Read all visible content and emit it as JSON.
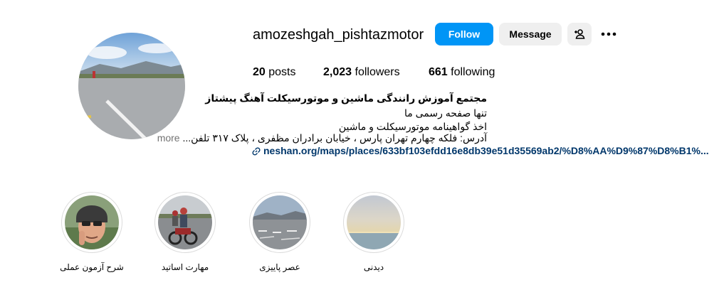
{
  "profile": {
    "username": "amozeshgah_pishtazmotor",
    "follow_label": "Follow",
    "message_label": "Message",
    "icons": {
      "suggest": "add-person-icon",
      "options": "more-options-icon",
      "link": "link-icon"
    },
    "accent_color": "#0095f6"
  },
  "stats": {
    "posts_count": "20",
    "posts_label": " posts",
    "followers_count": "2,023",
    "followers_label": " followers",
    "following_count": "661",
    "following_label": " following"
  },
  "bio": {
    "name": "مجتمع آموزش رانندگی ماشین و موتورسیکلت آهنگ پیشتاز",
    "line1": "تنها صفحه رسمی ما",
    "line2": "اخذ گواهینامه موتورسیکلت و ماشین",
    "line3": "آدرس: فلکه چهارم تهران پارس ، خیابان برادران مظفری ، پلاک ۳۱۷ تلفن...",
    "more_label": " more",
    "link": "neshan.org/maps/places/633bf103efdd16e8db39e51d35569ab2/%D8%AA%D9%87%D8%B1%..."
  },
  "highlights": [
    {
      "label": "شرح آزمون عملی"
    },
    {
      "label": "مهارت اساتید"
    },
    {
      "label": "عصر پاییزی"
    },
    {
      "label": "دیدنی"
    }
  ]
}
